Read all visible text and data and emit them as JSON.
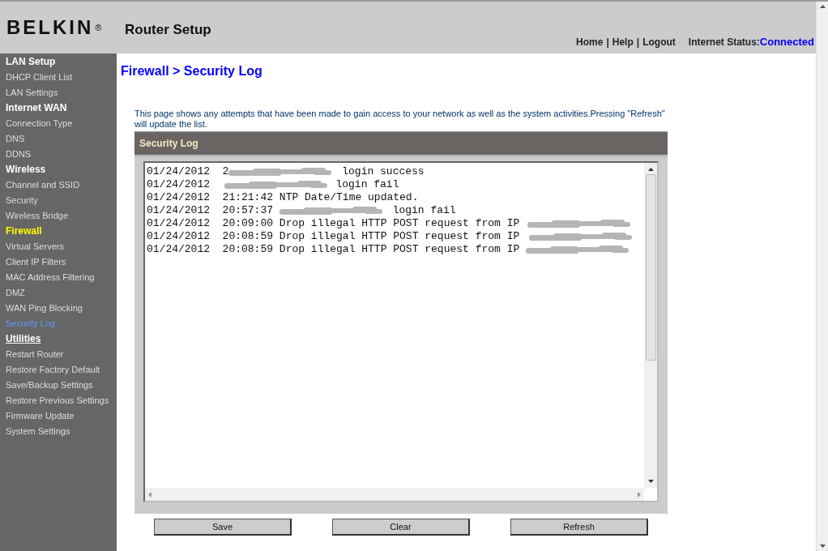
{
  "header": {
    "logo": "BELKIN",
    "logo_mark": "®",
    "title": "Router Setup",
    "links": [
      "Home",
      "Help",
      "Logout"
    ],
    "link_separator": "|",
    "status_label": "Internet Status:",
    "status_value": "Connected"
  },
  "sidebar": {
    "sections": [
      {
        "heading": "LAN Setup",
        "selected": false,
        "underlined": false,
        "items": [
          {
            "label": "DHCP Client List",
            "selected": false
          },
          {
            "label": "LAN Settings",
            "selected": false
          }
        ]
      },
      {
        "heading": "Internet WAN",
        "selected": false,
        "underlined": false,
        "items": [
          {
            "label": "Connection Type",
            "selected": false
          },
          {
            "label": "DNS",
            "selected": false
          },
          {
            "label": "DDNS",
            "selected": false
          }
        ]
      },
      {
        "heading": "Wireless",
        "selected": false,
        "underlined": false,
        "items": [
          {
            "label": "Channel and SSID",
            "selected": false
          },
          {
            "label": "Security",
            "selected": false
          },
          {
            "label": "Wireless Bridge",
            "selected": false
          }
        ]
      },
      {
        "heading": "Firewall",
        "selected": true,
        "underlined": false,
        "items": [
          {
            "label": "Virtual Servers",
            "selected": false
          },
          {
            "label": "Client IP Filters",
            "selected": false
          },
          {
            "label": "MAC Address Filtering",
            "selected": false
          },
          {
            "label": "DMZ",
            "selected": false
          },
          {
            "label": "WAN Ping Blocking",
            "selected": false
          },
          {
            "label": "Security Log",
            "selected": true
          }
        ]
      },
      {
        "heading": "Utilities",
        "selected": false,
        "underlined": true,
        "items": [
          {
            "label": "Restart Router",
            "selected": false
          },
          {
            "label": "Restore Factory Default",
            "selected": false
          },
          {
            "label": "Save/Backup Settings",
            "selected": false
          },
          {
            "label": "Restore Previous Settings",
            "selected": false
          },
          {
            "label": "Firmware Update",
            "selected": false
          },
          {
            "label": "System Settings",
            "selected": false
          }
        ]
      }
    ]
  },
  "page": {
    "breadcrumb": "Firewall > Security Log",
    "description": "This page shows any attempts that have been made to gain access to your network as well as the system activities.Pressing \"Refresh\" will update the list.",
    "panel_title": "Security Log",
    "log": [
      {
        "text_before": "01/24/2012  2",
        "redacted": true,
        "text_after": " login success"
      },
      {
        "text_before": "01/24/2012  ",
        "redacted": true,
        "text_after": " login fail"
      },
      {
        "text_before": "01/24/2012  21:21:42 NTP Date/Time updated.",
        "redacted": false
      },
      {
        "text_before": "01/24/2012  20:57:37 ",
        "redacted": true,
        "text_after": " login fail"
      },
      {
        "text_before": "01/24/2012  20:09:00 Drop illegal HTTP POST request from IP ",
        "redacted": true
      },
      {
        "text_before": "01/24/2012  20:08:59 Drop illegal HTTP POST request from IP ",
        "redacted": true
      },
      {
        "text_before": "01/24/2012  20:08:59 Drop illegal HTTP POST request from IP ",
        "redacted": true
      }
    ],
    "buttons": [
      "Save",
      "Clear",
      "Refresh"
    ]
  }
}
